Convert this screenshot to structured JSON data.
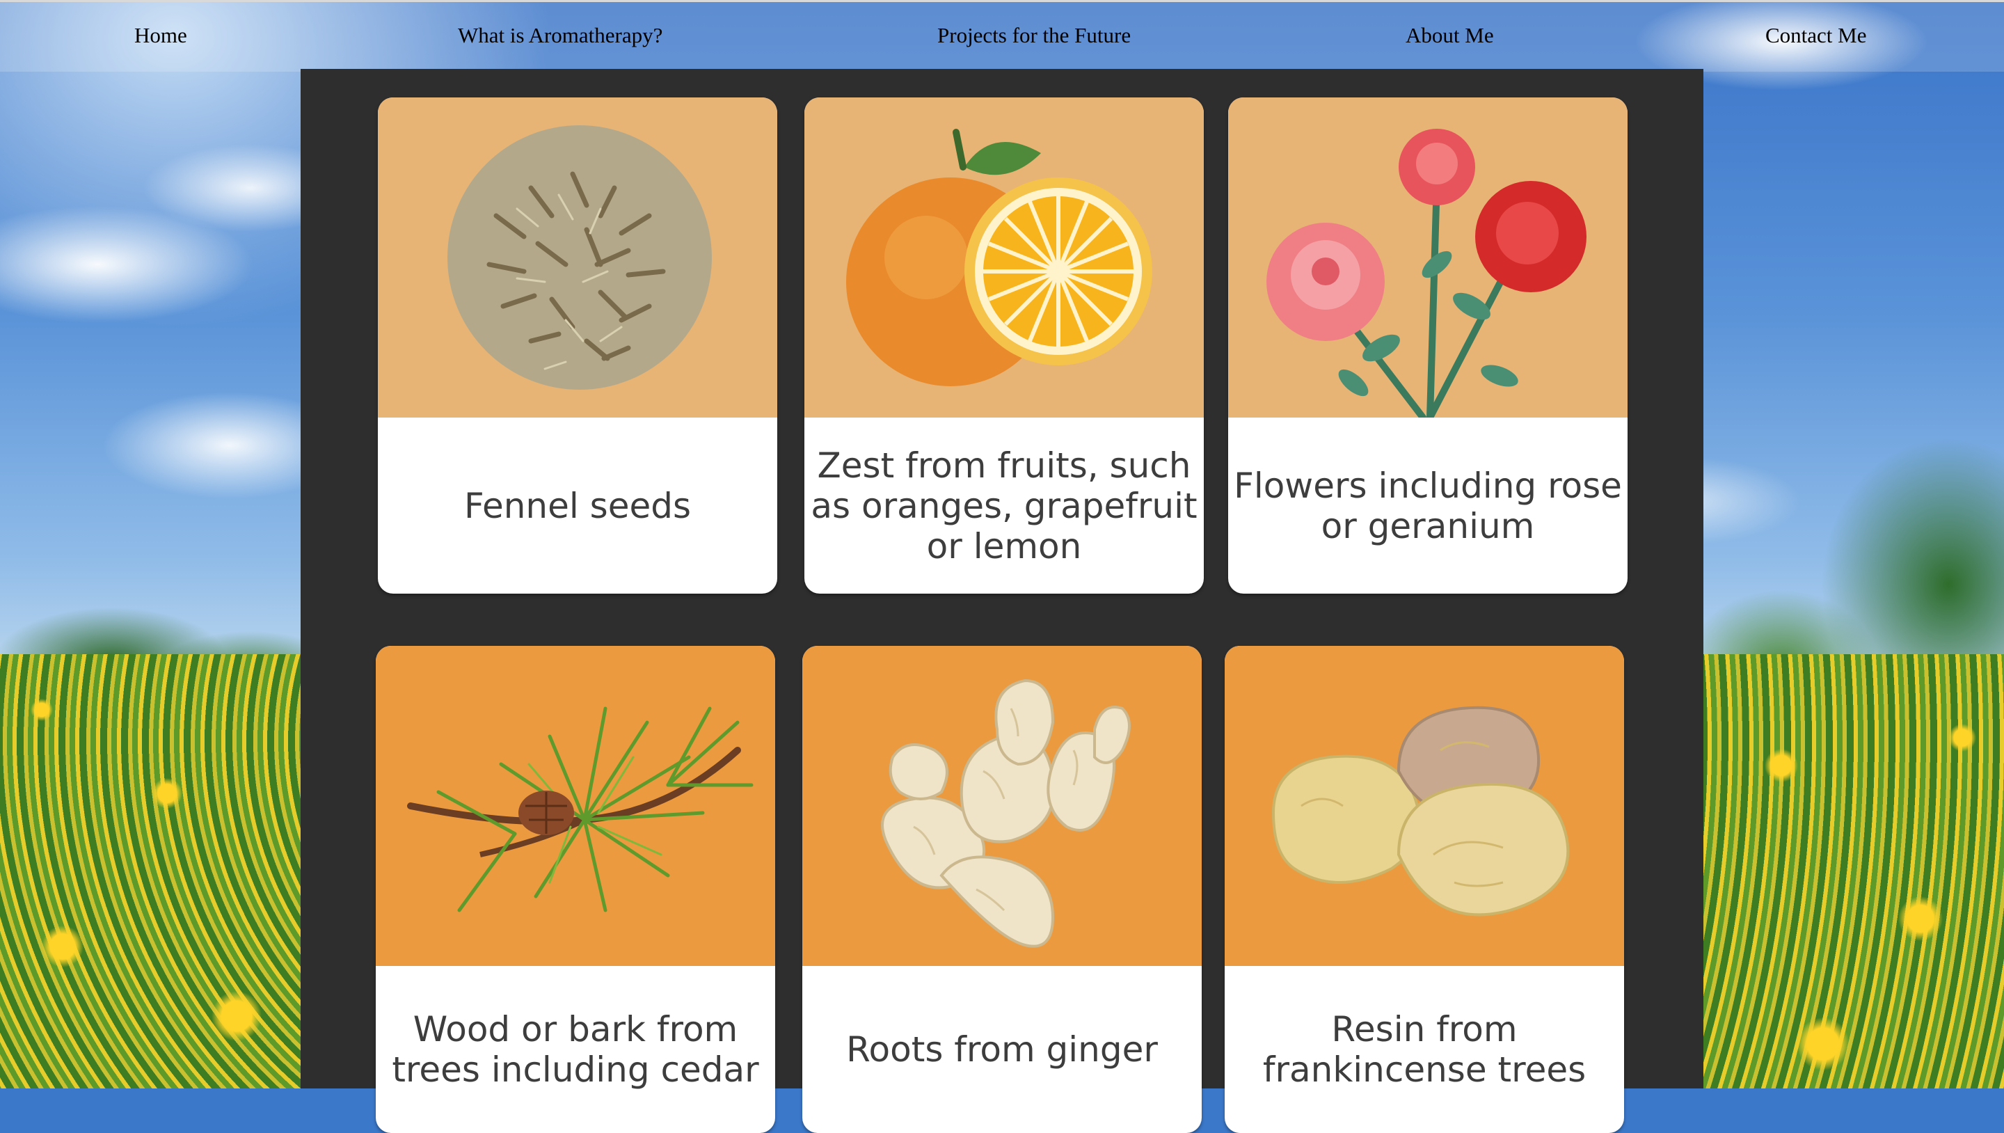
{
  "nav": {
    "items": [
      {
        "label": "Home"
      },
      {
        "label": "What is Aromatherapy?"
      },
      {
        "label": "Projects for the Future"
      },
      {
        "label": "About Me"
      },
      {
        "label": "Contact Me"
      }
    ]
  },
  "cards": [
    {
      "label": "Fennel seeds",
      "icon": "fennel-seeds-icon"
    },
    {
      "label": "Zest from fruits, such as oranges, grapefruit or lemon",
      "icon": "citrus-icon"
    },
    {
      "label": "Flowers including rose or geranium",
      "icon": "roses-icon"
    },
    {
      "label": "Wood or bark from trees including cedar",
      "icon": "pine-branch-icon"
    },
    {
      "label": "Roots from ginger",
      "icon": "ginger-root-icon"
    },
    {
      "label": "Resin  from frankincense trees",
      "icon": "resin-icon"
    }
  ],
  "colors": {
    "panel": "#2e2e2e",
    "card_art_light": "#e8b476",
    "card_art_dark": "#ec9a3f",
    "card_text": "#3d3d3d"
  }
}
